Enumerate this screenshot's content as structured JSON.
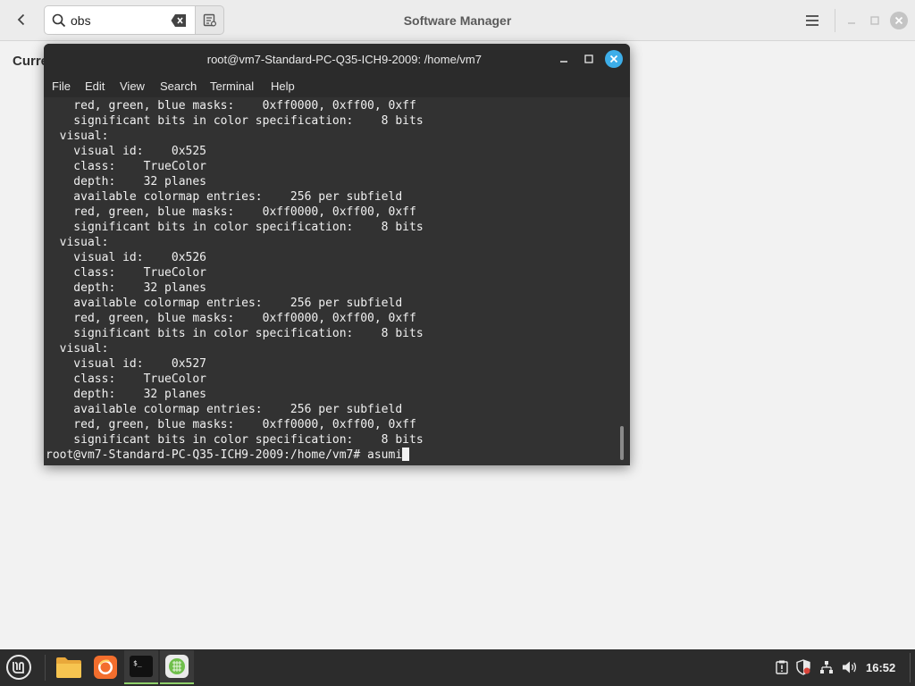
{
  "software_manager": {
    "title": "Software Manager",
    "search_value": "obs",
    "current_heading": "Curre"
  },
  "terminal": {
    "title": "root@vm7-Standard-PC-Q35-ICH9-2009: /home/vm7",
    "menu": [
      "File",
      "Edit",
      "View",
      "Search",
      "Terminal",
      "Help"
    ],
    "output_lines": [
      "    red, green, blue masks:    0xff0000, 0xff00, 0xff",
      "    significant bits in color specification:    8 bits",
      "  visual:",
      "    visual id:    0x525",
      "    class:    TrueColor",
      "    depth:    32 planes",
      "    available colormap entries:    256 per subfield",
      "    red, green, blue masks:    0xff0000, 0xff00, 0xff",
      "    significant bits in color specification:    8 bits",
      "  visual:",
      "    visual id:    0x526",
      "    class:    TrueColor",
      "    depth:    32 planes",
      "    available colormap entries:    256 per subfield",
      "    red, green, blue masks:    0xff0000, 0xff00, 0xff",
      "    significant bits in color specification:    8 bits",
      "  visual:",
      "    visual id:    0x527",
      "    class:    TrueColor",
      "    depth:    32 planes",
      "    available colormap entries:    256 per subfield",
      "    red, green, blue masks:    0xff0000, 0xff00, 0xff",
      "    significant bits in color specification:    8 bits"
    ],
    "prompt": "root@vm7-Standard-PC-Q35-ICH9-2009:/home/vm7# ",
    "typed_command": "asumi"
  },
  "taskbar": {
    "launchers": [
      {
        "name": "files",
        "icon": "folder-icon"
      },
      {
        "name": "firefox",
        "icon": "firefox-icon"
      },
      {
        "name": "terminal",
        "icon": "terminal-icon"
      },
      {
        "name": "software-manager",
        "icon": "software-manager-icon"
      }
    ],
    "clock": "16:52"
  },
  "colors": {
    "terminal_bg": "#323232",
    "close_accent": "#3daee9",
    "taskbar_bg": "#2c2c2c",
    "active_indicator": "#8fd16b"
  }
}
